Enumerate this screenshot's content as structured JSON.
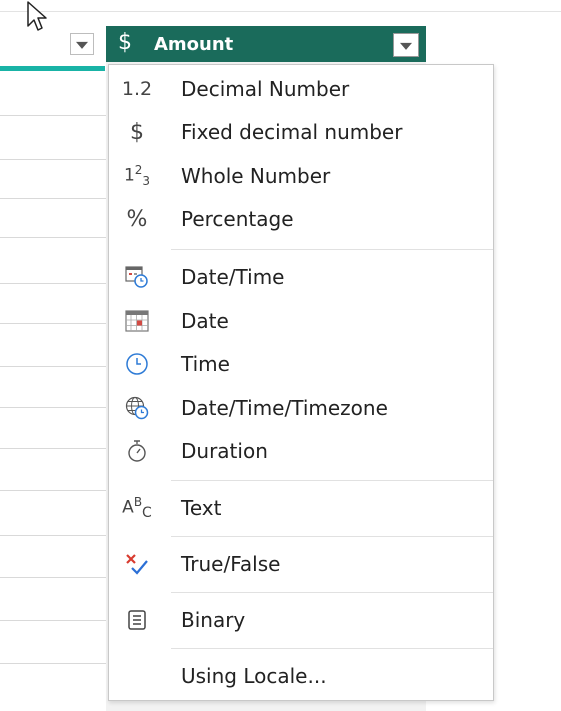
{
  "column": {
    "type_symbol": "$",
    "name": "Amount"
  },
  "menu": {
    "items": [
      {
        "label": "Decimal Number",
        "icon": "decimal-number-icon",
        "glyph": "1.2"
      },
      {
        "label": "Fixed decimal number",
        "icon": "fixed-decimal-icon",
        "glyph": "$"
      },
      {
        "label": "Whole Number",
        "icon": "whole-number-icon",
        "glyph": ""
      },
      {
        "label": "Percentage",
        "icon": "percentage-icon",
        "glyph": "%"
      },
      {
        "label": "Date/Time",
        "icon": "datetime-icon",
        "glyph": ""
      },
      {
        "label": "Date",
        "icon": "date-icon",
        "glyph": ""
      },
      {
        "label": "Time",
        "icon": "time-icon",
        "glyph": ""
      },
      {
        "label": "Date/Time/Timezone",
        "icon": "datetime-timezone-icon",
        "glyph": ""
      },
      {
        "label": "Duration",
        "icon": "duration-icon",
        "glyph": ""
      },
      {
        "label": "Text",
        "icon": "text-icon",
        "glyph": ""
      },
      {
        "label": "True/False",
        "icon": "true-false-icon",
        "glyph": ""
      },
      {
        "label": "Binary",
        "icon": "binary-icon",
        "glyph": ""
      },
      {
        "label": "Using Locale...",
        "icon": "",
        "glyph": ""
      }
    ]
  },
  "colors": {
    "header_bg": "#1a6b5b",
    "teal_accent": "#19b3a6",
    "check_blue": "#2b6fd6",
    "cross_red": "#d83b2f",
    "icon_blue": "#2e7bd6"
  }
}
